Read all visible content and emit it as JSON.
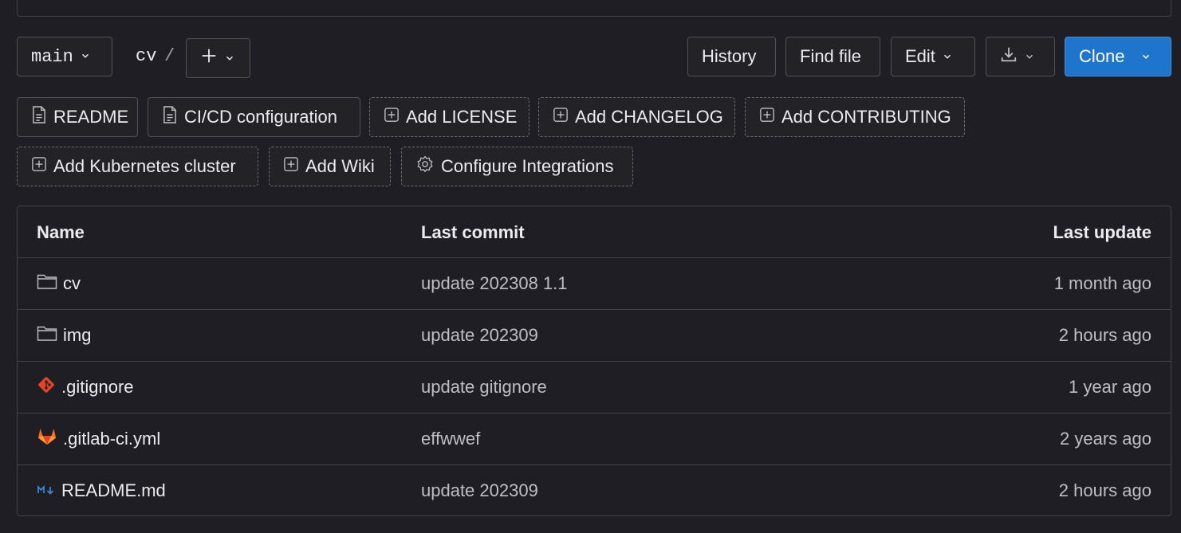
{
  "toolbar": {
    "branch": "main",
    "breadcrumb": {
      "path": "cv",
      "separator": "/"
    },
    "history_label": "History",
    "find_file_label": "Find file",
    "edit_label": "Edit",
    "clone_label": "Clone"
  },
  "quick_actions": [
    {
      "label": "README",
      "icon": "file-icon",
      "style": "solid"
    },
    {
      "label": "CI/CD configuration",
      "icon": "file-icon",
      "style": "solid"
    },
    {
      "label": "Add LICENSE",
      "icon": "plus-square-icon",
      "style": "dashed"
    },
    {
      "label": "Add CHANGELOG",
      "icon": "plus-square-icon",
      "style": "dashed"
    },
    {
      "label": "Add CONTRIBUTING",
      "icon": "plus-square-icon",
      "style": "dashed"
    },
    {
      "label": "Add Kubernetes cluster",
      "icon": "plus-square-icon",
      "style": "dashed"
    },
    {
      "label": "Add Wiki",
      "icon": "plus-square-icon",
      "style": "dashed"
    },
    {
      "label": "Configure Integrations",
      "icon": "settings-icon",
      "style": "dashed"
    }
  ],
  "file_table": {
    "headers": {
      "name": "Name",
      "last_commit": "Last commit",
      "last_update": "Last update"
    },
    "rows": [
      {
        "name": "cv",
        "icon": "folder-icon",
        "commit": "update 202308 1.1",
        "updated": "1 month ago"
      },
      {
        "name": "img",
        "icon": "folder-icon",
        "commit": "update 202309",
        "updated": "2 hours ago"
      },
      {
        "name": ".gitignore",
        "icon": "git-icon",
        "commit": "update gitignore",
        "updated": "1 year ago"
      },
      {
        "name": ".gitlab-ci.yml",
        "icon": "gitlab-icon",
        "commit": "effwwef",
        "updated": "2 years ago"
      },
      {
        "name": "README.md",
        "icon": "markdown-icon",
        "commit": "update 202309",
        "updated": "2 hours ago"
      }
    ]
  },
  "colors": {
    "background": "#1f1e24",
    "border": "#434248",
    "primary": "#1f75cb",
    "git": "#e24329",
    "markdown": "#428fdc"
  }
}
